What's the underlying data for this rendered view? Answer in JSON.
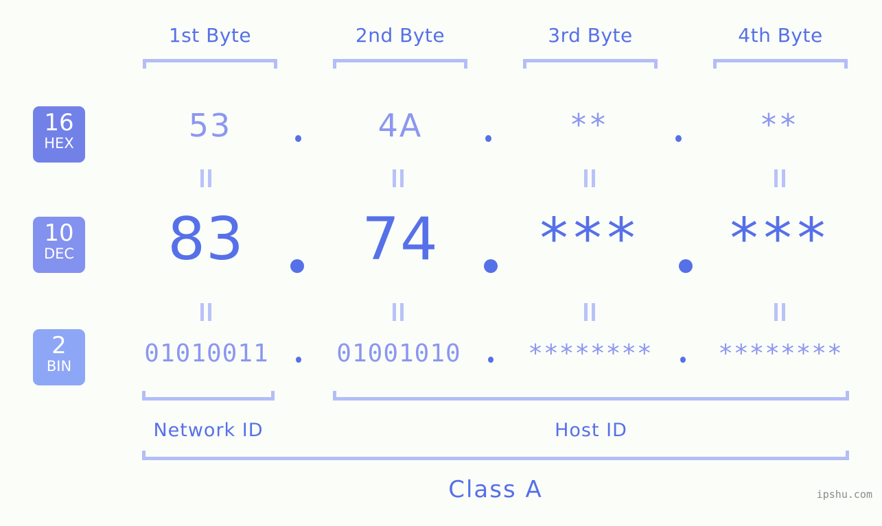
{
  "background_color": "#fbfdf9",
  "accent_color": "#5670e8",
  "muted_accent_color": "#8b97ef",
  "bracket_color": "#b3bdf7",
  "headers": {
    "bytes": [
      {
        "label": "1st Byte"
      },
      {
        "label": "2nd Byte"
      },
      {
        "label": "3rd Byte"
      },
      {
        "label": "4th Byte"
      }
    ]
  },
  "rows": [
    {
      "key": "hex",
      "badge_number": "16",
      "badge_abbr": "HEX",
      "badge_color": "#7281e8",
      "values": [
        "53",
        "4A",
        "**",
        "**"
      ],
      "separator": "."
    },
    {
      "key": "dec",
      "badge_number": "10",
      "badge_abbr": "DEC",
      "badge_color": "#8391ef",
      "values": [
        "83",
        "74",
        "***",
        "***"
      ],
      "separator": "."
    },
    {
      "key": "bin",
      "badge_number": "2",
      "badge_abbr": "BIN",
      "badge_color": "#8da6f5",
      "values": [
        "01010011",
        "01001010",
        "********",
        "********"
      ],
      "separator": "."
    }
  ],
  "equality_marks": {
    "glyph": "||",
    "count_top": 4,
    "count_bottom": 4
  },
  "sections": {
    "network_id_label": "Network ID",
    "host_id_label": "Host ID",
    "class_label": "Class A"
  },
  "watermark": "ipshu.com"
}
